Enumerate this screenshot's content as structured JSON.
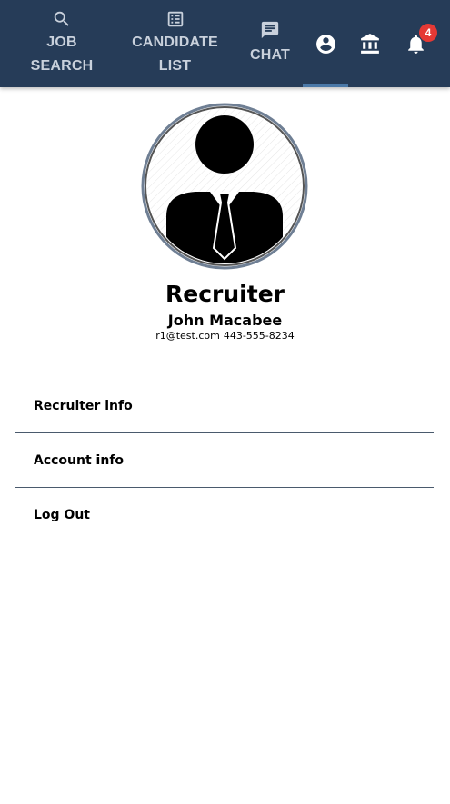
{
  "nav": {
    "tabs": [
      {
        "label": "JOB\nSEARCH",
        "icon": "search-icon"
      },
      {
        "label": "CANDIDATE\nLIST",
        "icon": "list-icon"
      },
      {
        "label": "CHAT",
        "icon": "chat-icon"
      }
    ],
    "icons": [
      "account-circle-icon",
      "bank-icon",
      "bell-icon"
    ],
    "notification_count": "4",
    "colors": {
      "bar": "#263c58",
      "tab_text": "#c9d1dc",
      "active_indicator": "#4b79a8",
      "badge": "#e53935"
    }
  },
  "profile": {
    "role": "Recruiter",
    "name": "John Macabee",
    "email": "r1@test.com",
    "phone": "443-555-8234"
  },
  "menu": [
    {
      "label": "Recruiter info"
    },
    {
      "label": "Account info"
    },
    {
      "label": "Log Out"
    }
  ]
}
